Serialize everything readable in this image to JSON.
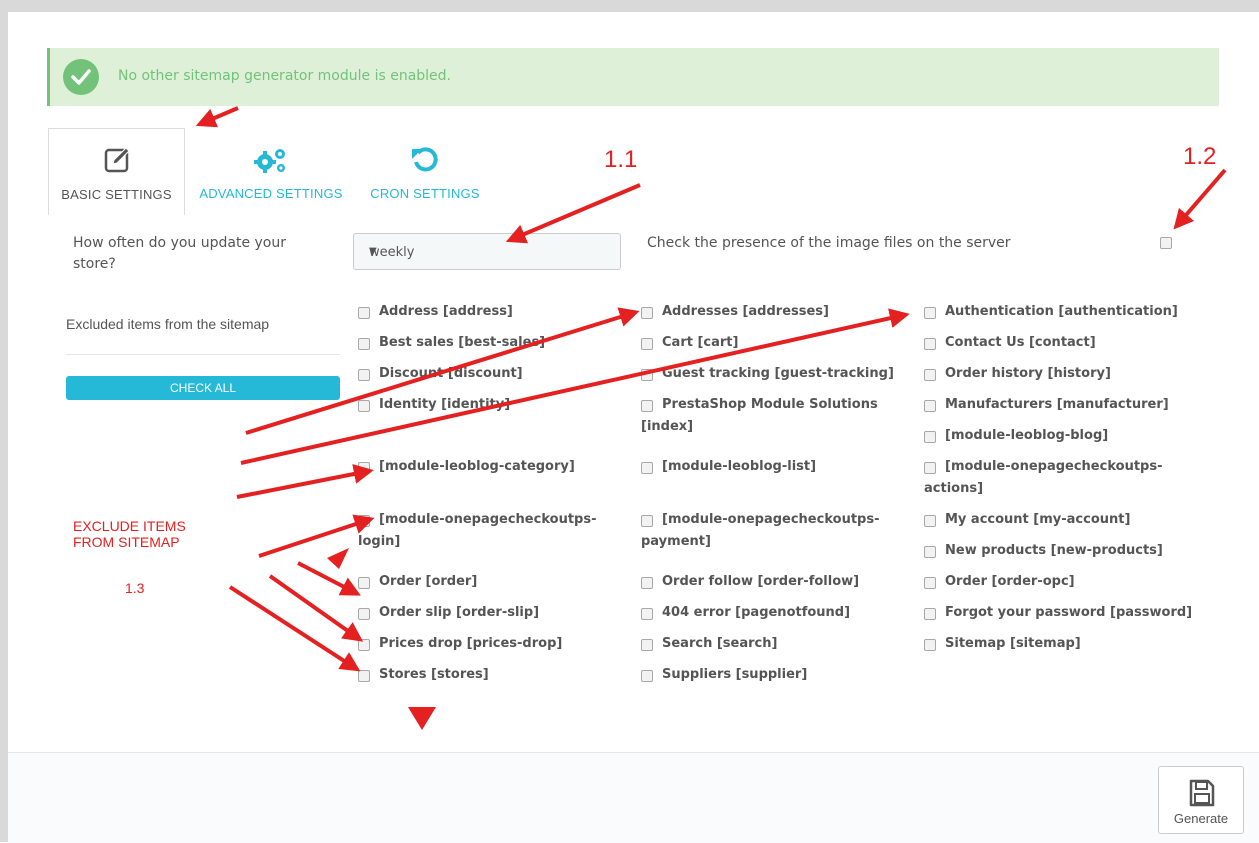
{
  "alert": {
    "icon": "check-circle-icon",
    "text": "No other sitemap generator module is enabled."
  },
  "tabs": [
    {
      "label": "BASIC SETTINGS",
      "icon": "edit-icon",
      "active": true
    },
    {
      "label": "ADVANCED SETTINGS",
      "icon": "gears-icon",
      "active": false
    },
    {
      "label": "CRON SETTINGS",
      "icon": "refresh-icon",
      "active": false
    }
  ],
  "form": {
    "update_label_line1": "How often do you update your",
    "update_label_line2": "store?",
    "update_value": "weekly",
    "image_check_label": "Check the presence of the image files on the server",
    "excluded_label": "Excluded items from the sitemap",
    "check_all": "CHECK ALL"
  },
  "pages": {
    "col1": [
      {
        "lines": [
          "Address [address]"
        ]
      },
      {
        "lines": [
          "Best sales [best-sales]"
        ]
      },
      {
        "lines": [
          "Discount [discount]"
        ]
      },
      {
        "lines": [
          "Identity [identity]"
        ]
      },
      {
        "lines": [
          "[module-leoblog-category]"
        ]
      },
      {
        "lines": [
          "[module-onepagecheckoutps-",
          "login]"
        ]
      },
      {
        "lines": [
          "Order [order]"
        ]
      },
      {
        "lines": [
          "Order slip [order-slip]"
        ]
      },
      {
        "lines": [
          "Prices drop [prices-drop]"
        ]
      },
      {
        "lines": [
          "Stores [stores]"
        ]
      }
    ],
    "col2": [
      {
        "lines": [
          "Addresses [addresses]"
        ]
      },
      {
        "lines": [
          "Cart [cart]"
        ]
      },
      {
        "lines": [
          "Guest tracking [guest-tracking]"
        ]
      },
      {
        "lines": [
          "PrestaShop Module Solutions",
          "[index]"
        ]
      },
      {
        "lines": [
          "[module-leoblog-list]"
        ]
      },
      {
        "lines": [
          "[module-onepagecheckoutps-",
          "payment]"
        ]
      },
      {
        "lines": [
          "Order follow [order-follow]"
        ]
      },
      {
        "lines": [
          "404 error [pagenotfound]"
        ]
      },
      {
        "lines": [
          "Search [search]"
        ]
      },
      {
        "lines": [
          "Suppliers [supplier]"
        ]
      }
    ],
    "col3": [
      {
        "lines": [
          "Authentication [authentication]"
        ]
      },
      {
        "lines": [
          "Contact Us [contact]"
        ]
      },
      {
        "lines": [
          "Order history [history]"
        ]
      },
      {
        "lines": [
          "Manufacturers [manufacturer]"
        ]
      },
      {
        "lines": [
          "[module-leoblog-blog]"
        ]
      },
      {
        "lines": [
          "[module-onepagecheckoutps-",
          "actions]"
        ]
      },
      {
        "lines": [
          "My account [my-account]"
        ]
      },
      {
        "lines": [
          "New products [new-products]"
        ]
      },
      {
        "lines": [
          "Order [order-opc]"
        ]
      },
      {
        "lines": [
          "Forgot your password [password]"
        ]
      },
      {
        "lines": [
          "Sitemap [sitemap]"
        ]
      }
    ]
  },
  "footer": {
    "generate_label": "Generate",
    "icon": "save-icon"
  },
  "annotations": {
    "a11": "1.1",
    "a12": "1.2",
    "a13": "1.3",
    "exclude_line1": "EXCLUDE ITEMS",
    "exclude_line2": "FROM SITEMAP",
    "color": "#e52020"
  },
  "colors": {
    "accent": "#25b9d7",
    "success": "#72c279",
    "success_bg": "#dff0d8"
  }
}
